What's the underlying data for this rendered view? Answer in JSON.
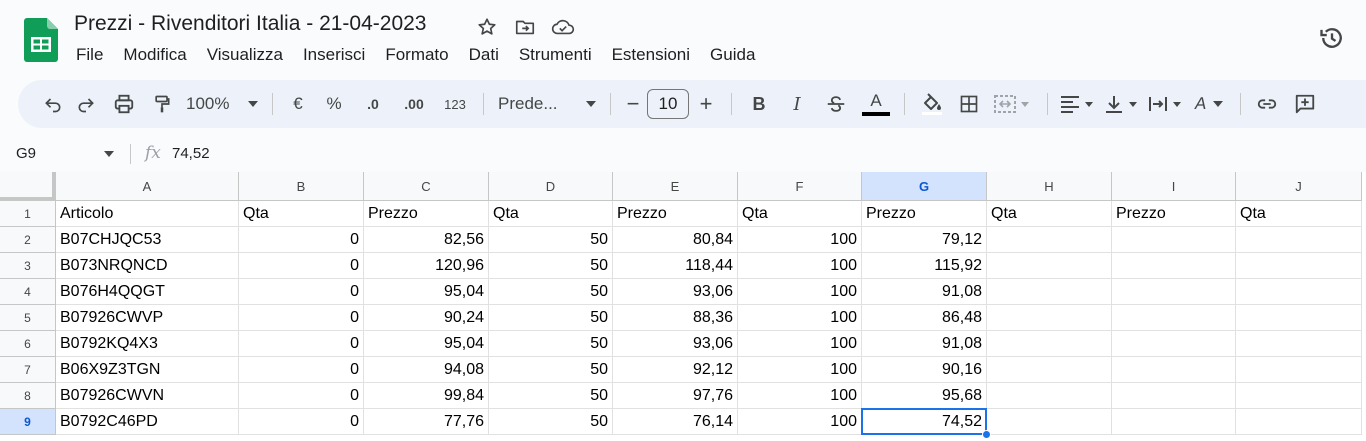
{
  "document": {
    "title": "Prezzi - Rivenditori Italia - 21-04-2023",
    "icons": [
      "star-icon",
      "move-folder-icon",
      "cloud-saved-icon"
    ]
  },
  "menu": [
    "File",
    "Modifica",
    "Visualizza",
    "Inserisci",
    "Formato",
    "Dati",
    "Strumenti",
    "Estensioni",
    "Guida"
  ],
  "toolbar": {
    "zoom": "100%",
    "currency": "€",
    "percent": "%",
    "decrease_decimals": ".0",
    "increase_decimals": ".00",
    "number_format": "123",
    "font": "Prede...",
    "font_size": "10",
    "minus": "−",
    "plus": "+",
    "bold": "B",
    "italic": "I",
    "text_color": "A",
    "text_rotation": "A"
  },
  "formula_bar": {
    "cell_ref": "G9",
    "fx": "fx",
    "value": "74,52"
  },
  "columns": [
    "A",
    "B",
    "C",
    "D",
    "E",
    "F",
    "G",
    "H",
    "I",
    "J"
  ],
  "selected_column": "G",
  "selected_row": 9,
  "rows": [
    {
      "n": "1",
      "cells": [
        "Articolo",
        "Qta",
        "Prezzo",
        "Qta",
        "Prezzo",
        "Qta",
        "Prezzo",
        "Qta",
        "Prezzo",
        "Qta"
      ]
    },
    {
      "n": "2",
      "cells": [
        "B07CHJQC53",
        "0",
        "82,56",
        "50",
        "80,84",
        "100",
        "79,12",
        "",
        "",
        ""
      ]
    },
    {
      "n": "3",
      "cells": [
        "B073NRQNCD",
        "0",
        "120,96",
        "50",
        "118,44",
        "100",
        "115,92",
        "",
        "",
        ""
      ]
    },
    {
      "n": "4",
      "cells": [
        "B076H4QQGT",
        "0",
        "95,04",
        "50",
        "93,06",
        "100",
        "91,08",
        "",
        "",
        ""
      ]
    },
    {
      "n": "5",
      "cells": [
        "B07926CWVP",
        "0",
        "90,24",
        "50",
        "88,36",
        "100",
        "86,48",
        "",
        "",
        ""
      ]
    },
    {
      "n": "6",
      "cells": [
        "B0792KQ4X3",
        "0",
        "95,04",
        "50",
        "93,06",
        "100",
        "91,08",
        "",
        "",
        ""
      ]
    },
    {
      "n": "7",
      "cells": [
        "B06X9Z3TGN",
        "0",
        "94,08",
        "50",
        "92,12",
        "100",
        "90,16",
        "",
        "",
        ""
      ]
    },
    {
      "n": "8",
      "cells": [
        "B07926CWVN",
        "0",
        "99,84",
        "50",
        "97,76",
        "100",
        "95,68",
        "",
        "",
        ""
      ]
    },
    {
      "n": "9",
      "cells": [
        "B0792C46PD",
        "0",
        "77,76",
        "50",
        "76,14",
        "100",
        "74,52",
        "",
        "",
        ""
      ]
    }
  ],
  "colors": {
    "accent": "#1a73e8",
    "selected_header": "#d3e3fd",
    "sheets_green": "#0f9d58"
  }
}
